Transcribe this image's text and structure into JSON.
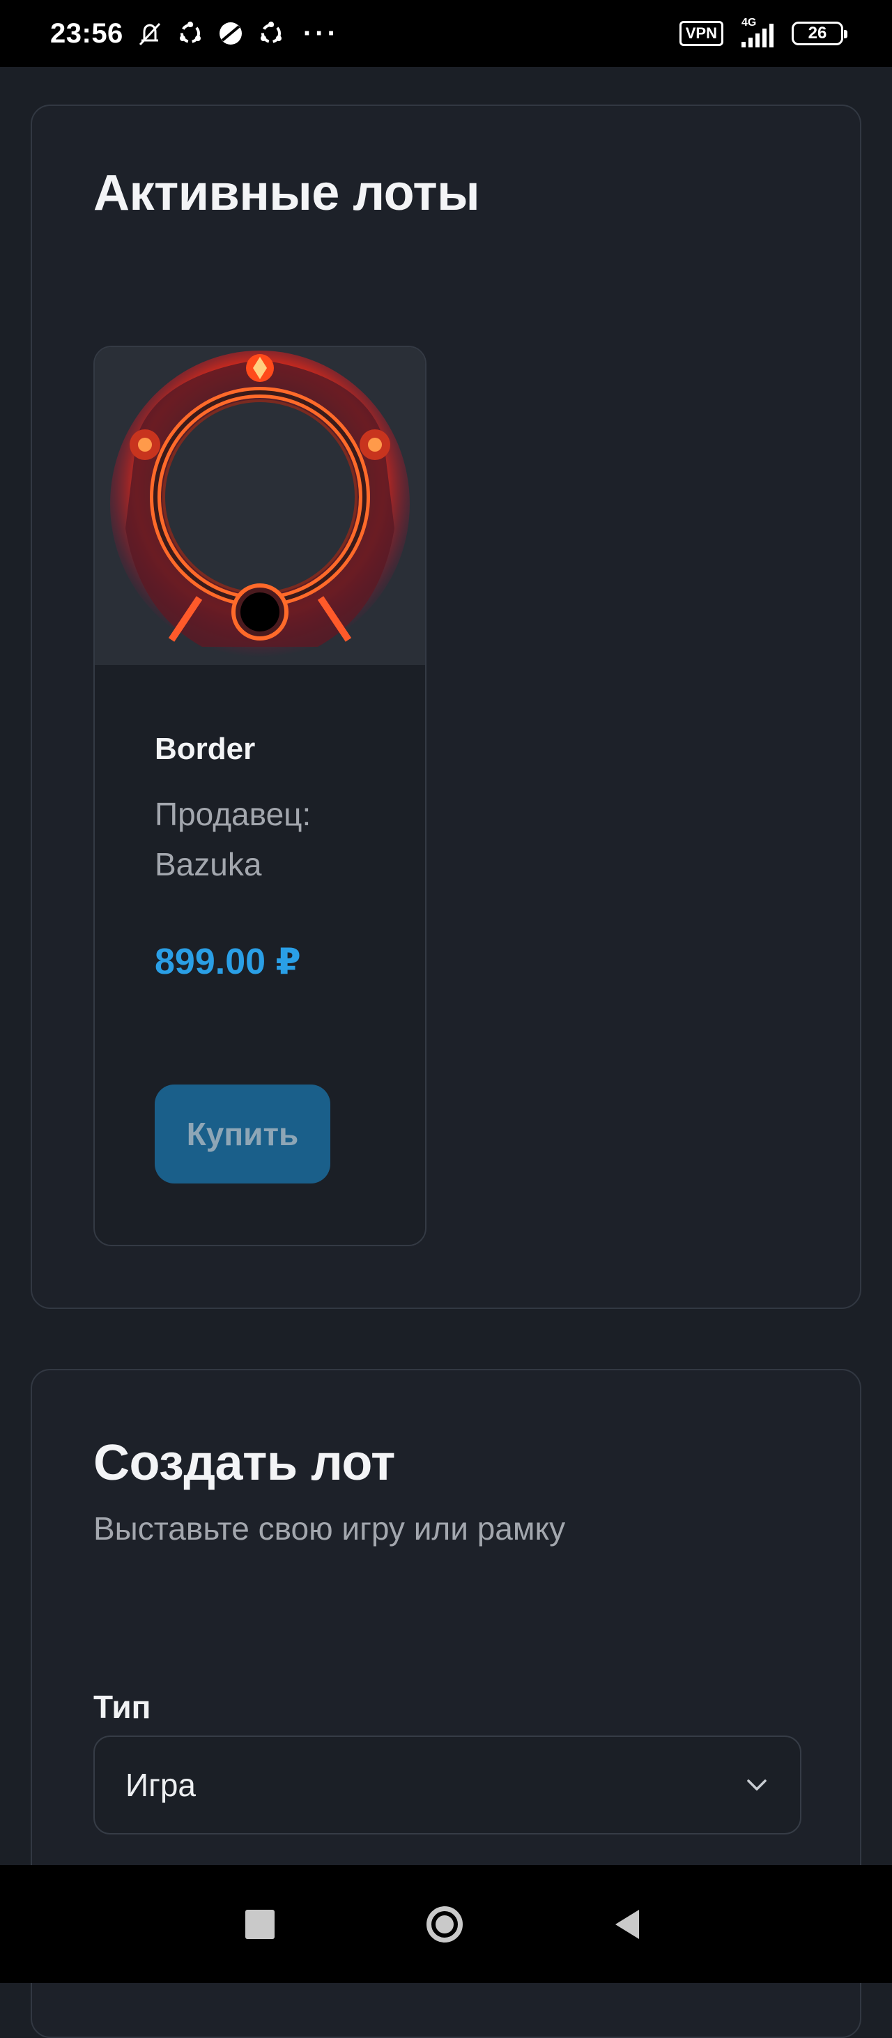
{
  "status_bar": {
    "time": "23:56",
    "icons": [
      "bell-muted-icon",
      "sync-icon",
      "vpn-ball-icon",
      "sync-icon"
    ],
    "more": "···",
    "vpn": "VPN",
    "network": "4G",
    "battery": "26"
  },
  "active_lots": {
    "title": "Активные лоты",
    "items": [
      {
        "image": "fiery-round-frame-image",
        "name": "Border",
        "seller": "Продавец: Bazuka",
        "price": "899.00 ₽",
        "buy_label": "Купить"
      }
    ]
  },
  "create_lot": {
    "title": "Создать лот",
    "subtitle": "Выставьте свою игру или рамку",
    "type_label": "Тип",
    "type_value": "Игра"
  },
  "nav_bar": {
    "icons": [
      "recent-apps-icon",
      "home-icon",
      "back-icon"
    ]
  },
  "colors": {
    "background": "#1b1f26",
    "price": "#2a9fe6",
    "button": "#1a5f8a"
  }
}
